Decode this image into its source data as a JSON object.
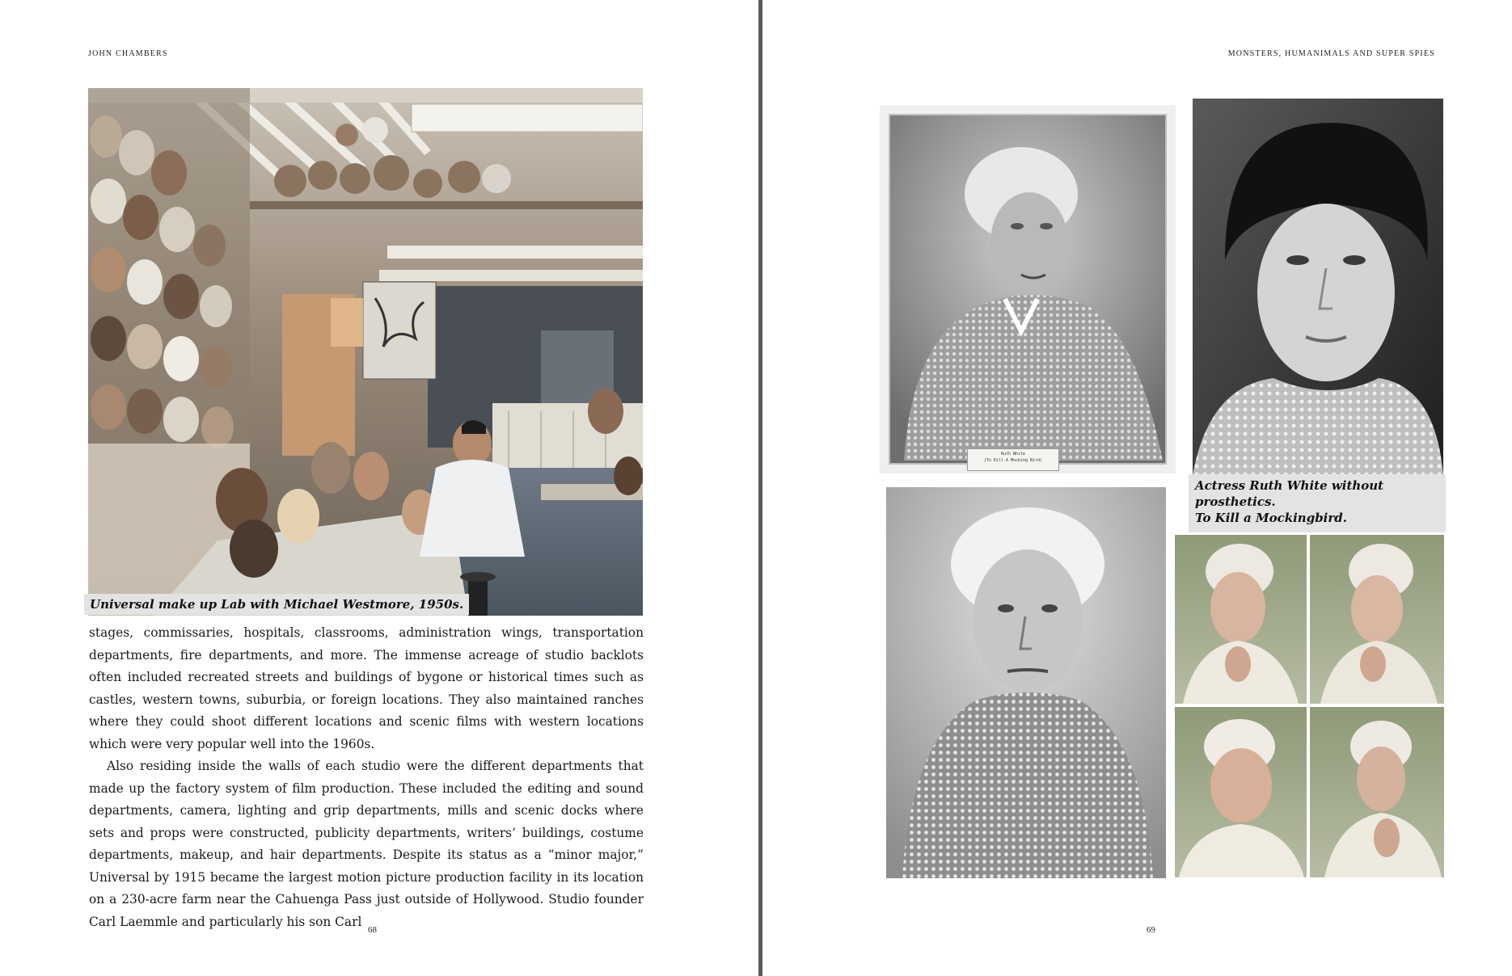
{
  "left_page": {
    "running_head": "JOHN CHAMBERS",
    "caption": "Universal make up Lab with Michael Westmore, 1950s.",
    "paragraphs": [
      "stages, commissaries, hospitals, classrooms, administration wings, transportation departments, fire departments, and more. The immense acreage of studio backlots often included recreated streets and buildings of bygone or historical times such as castles, western towns, suburbia, or foreign locations. They also maintained ranches where they could shoot different locations and scenic films with western locations which were very popular well into the 1960s.",
      "Also residing inside the walls of each studio were the different departments that made up the factory system of film production. These included the editing and sound departments, camera, lighting and grip departments, mills and scenic docks where sets and props were constructed, publicity departments, writers’ buildings, costume departments, makeup, and hair departments. Despite its status as a “minor major,” Universal by 1915 became the largest motion picture production facility in its location on a 230-acre farm near the Cahuenga Pass just outside of Hollywood. Studio founder Carl Laemmle and particularly his son Carl"
    ],
    "page_number": "68"
  },
  "right_page": {
    "running_head": "MONSTERS, HUMANIMALS AND SUPER SPIES",
    "caption_line1": "Actress Ruth White without prosthetics.",
    "caption_line2": "To Kill a Mockingbird.",
    "photo_label_line1": "Ruth White",
    "photo_label_line2": "(To Kill A Mocking Bird)",
    "page_number": "69"
  }
}
